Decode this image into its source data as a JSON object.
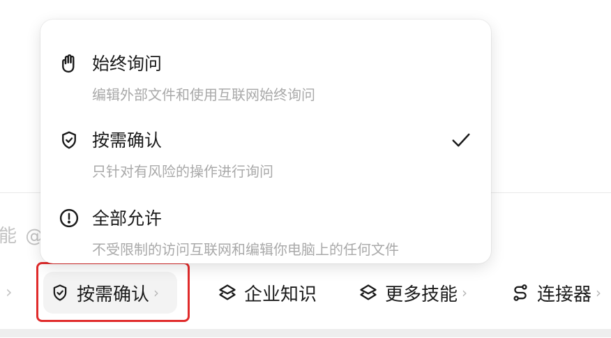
{
  "menu": {
    "items": [
      {
        "title": "始终询问",
        "desc": "编辑外部文件和使用互联网始终询问",
        "icon": "hand-icon",
        "selected": false
      },
      {
        "title": "按需确认",
        "desc": "只针对有风险的操作进行询问",
        "icon": "shield-check-icon",
        "selected": true
      },
      {
        "title": "全部允许",
        "desc": "不受限制的访问互联网和编辑你电脑上的任何文件",
        "icon": "alert-circle-icon",
        "selected": false
      }
    ]
  },
  "composer": {
    "placeholder_fragment": "能 @"
  },
  "toolbar": {
    "permission_label": "按需确认",
    "knowledge_label": "企业知识",
    "skills_label": "更多技能",
    "connectors_label": "连接器"
  },
  "colors": {
    "highlight": "#e02a2a",
    "muted_text": "#a9a9a9",
    "primary_text": "#1a1a1a"
  }
}
